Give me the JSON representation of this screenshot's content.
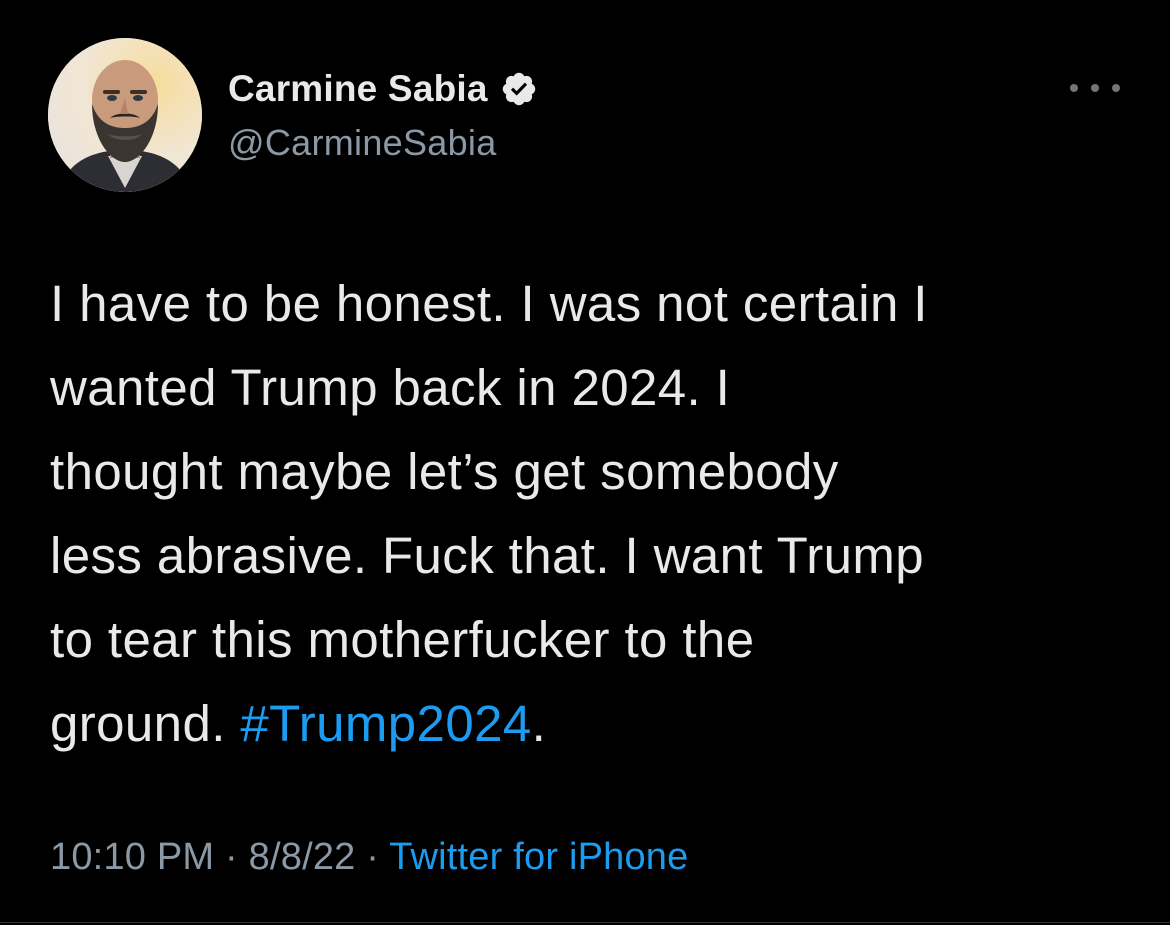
{
  "author": {
    "display_name": "Carmine Sabia",
    "handle": "@CarmineSabia",
    "verified": true
  },
  "tweet": {
    "lines": [
      "I have to be honest. I was not certain I",
      "wanted Trump back in 2024. I",
      "thought maybe let’s get somebody",
      "less abrasive. Fuck that. I want Trump",
      "to tear this motherfucker to the",
      "ground. "
    ],
    "hashtag": "#Trump2024",
    "trailing": "."
  },
  "meta": {
    "time": "10:10 PM",
    "sep1": " · ",
    "date": "8/8/22",
    "sep2": " · ",
    "source": "Twitter for iPhone"
  },
  "icons": {
    "verified": "verified-badge-icon",
    "more": "more-options-icon",
    "avatar": "profile-avatar"
  },
  "colors": {
    "background": "#000000",
    "text": "#e7e9ea",
    "secondary": "#8b98a5",
    "accent": "#1d9bf0"
  }
}
